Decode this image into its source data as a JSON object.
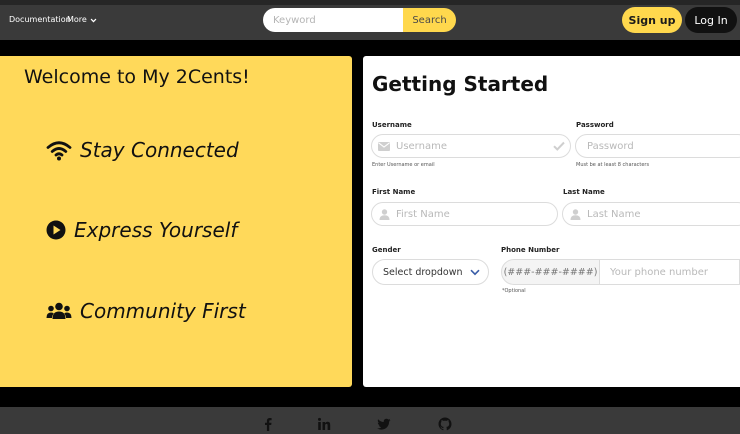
{
  "nav": {
    "documentation": "Documentation",
    "more": "More",
    "search_placeholder": "Keyword",
    "search_button": "Search",
    "signup": "Sign up",
    "login": "Log In"
  },
  "welcome": {
    "title": "Welcome to My 2Cents!",
    "features": [
      {
        "label": "Stay Connected",
        "icon": "wifi-icon"
      },
      {
        "label": "Express Yourself",
        "icon": "play-circle-icon"
      },
      {
        "label": "Community First",
        "icon": "users-icon"
      }
    ]
  },
  "form": {
    "title": "Getting Started",
    "username": {
      "label": "Username",
      "placeholder": "Username",
      "help": "Enter Username or email"
    },
    "password": {
      "label": "Password",
      "placeholder": "Password",
      "help": "Must be at least 8 characters"
    },
    "first_name": {
      "label": "First Name",
      "placeholder": "First Name"
    },
    "last_name": {
      "label": "Last Name",
      "placeholder": "Last Name"
    },
    "gender": {
      "label": "Gender",
      "value": "Select dropdown"
    },
    "phone": {
      "label": "Phone Number",
      "prefix": "(###-###-####)",
      "placeholder": "Your phone number",
      "help": "*Optional"
    }
  },
  "footer": {
    "icons": [
      "facebook-icon",
      "linkedin-icon",
      "twitter-icon",
      "github-icon"
    ]
  },
  "colors": {
    "accent": "#ffd95a",
    "nav_bg": "#3a3a3a",
    "page_bg": "#000000"
  }
}
